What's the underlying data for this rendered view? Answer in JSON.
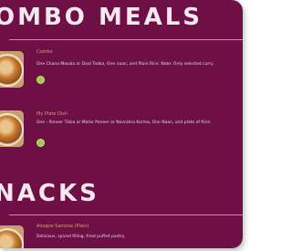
{
  "sections": {
    "combo": {
      "title": "OMBO MEALS",
      "items": [
        {
          "name": "Combo",
          "description": "One Chana Masala or Daal Tadka, One naan, and Plain Rice. Note: Only selected curry."
        },
        {
          "name": "My Plate Dish",
          "description": "One - Paneer Tikka or Matar Paneer or Navratna Korma, One Naan, and plate of Rice."
        }
      ]
    },
    "snacks": {
      "title": "NACKS",
      "items": [
        {
          "name": "Aloopie Samosa (Plain)",
          "description": "Delicious, spiced filling, fried puffed pastry."
        }
      ]
    }
  },
  "colors": {
    "card_background": "#6e0f45",
    "item_name": "#d9a06b",
    "veg_badge": "#a3c94a"
  },
  "icons": {
    "badge": "veg-badge-icon",
    "thumbnail": "dish-thumbnail"
  }
}
